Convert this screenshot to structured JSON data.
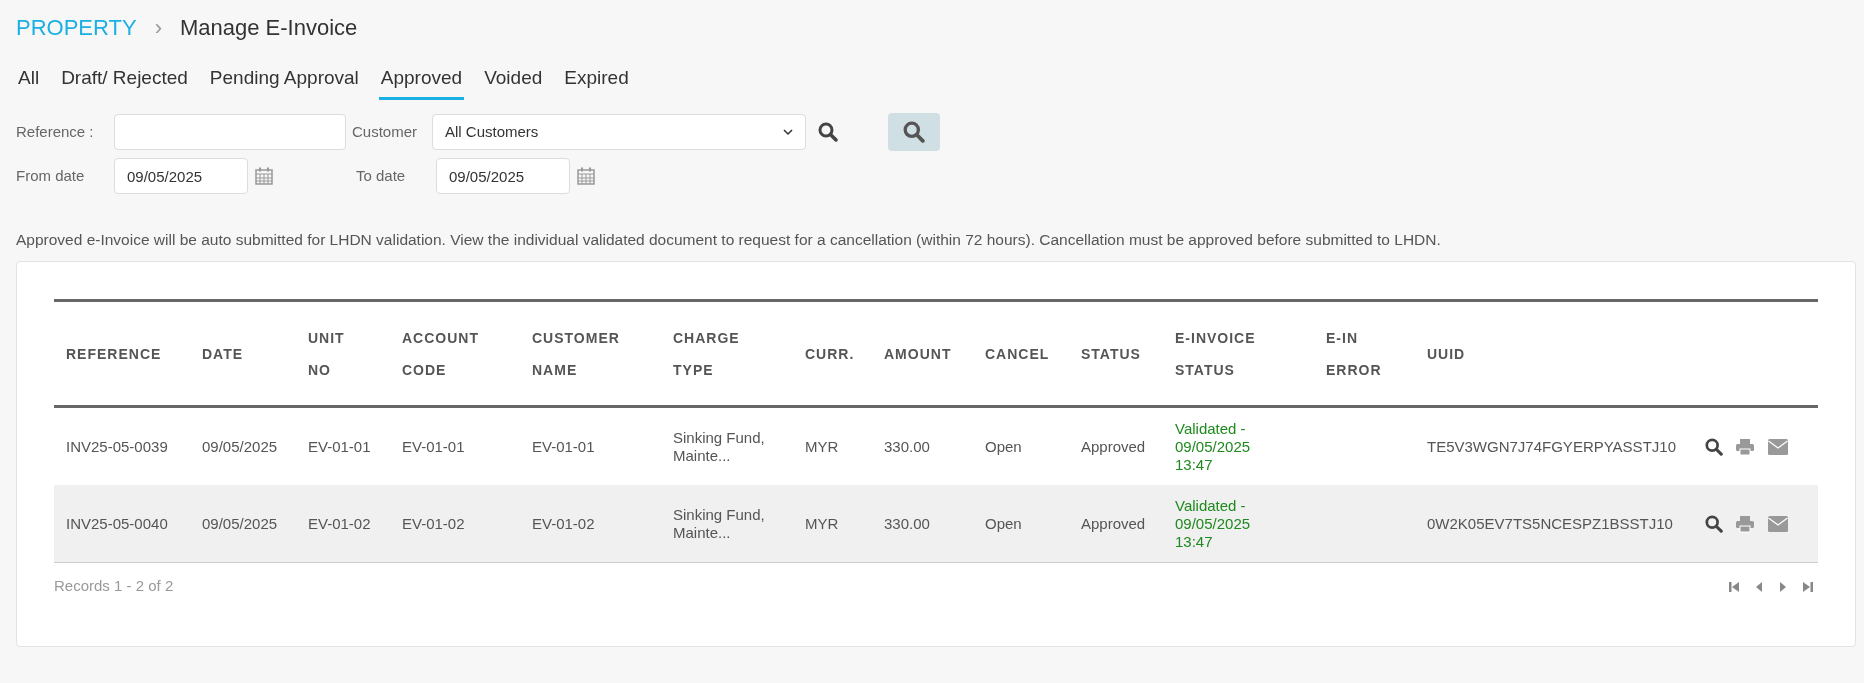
{
  "breadcrumb": {
    "root": "PROPERTY",
    "separator": "›",
    "current": "Manage E-Invoice"
  },
  "tabs": [
    {
      "label": "All",
      "selected": false
    },
    {
      "label": "Draft/ Rejected",
      "selected": false
    },
    {
      "label": "Pending Approval",
      "selected": false
    },
    {
      "label": "Approved",
      "selected": true
    },
    {
      "label": "Voided",
      "selected": false
    },
    {
      "label": "Expired",
      "selected": false
    }
  ],
  "filters": {
    "reference_label": "Reference :",
    "customer_label": "Customer",
    "customer_value": "All Customers",
    "from_label": "From date",
    "from_value": "09/05/2025",
    "to_label": "To date",
    "to_value": "09/05/2025"
  },
  "notice": "Approved e-Invoice will be auto submitted for LHDN validation. View the individual validated document to request for a cancellation (within 72 hours). Cancellation must be approved before submitted to LHDN.",
  "table": {
    "columns": [
      "REFERENCE",
      "DATE",
      "UNIT\nNO",
      "ACCOUNT\nCODE",
      "CUSTOMER\nNAME",
      "CHARGE\nTYPE",
      "CURR.",
      "AMOUNT",
      "CANCEL",
      "STATUS",
      "E-INVOICE\nSTATUS",
      "E-IN\nERROR",
      "UUID"
    ],
    "rows": [
      {
        "selected": false,
        "cells": [
          "INV25-05-0039",
          "09/05/2025",
          "EV-01-01",
          "EV-01-01",
          "EV-01-01",
          "Sinking Fund,\nMainte...",
          "MYR",
          "330.00",
          "Open",
          "Approved",
          "Validated -\n09/05/2025\n13:47",
          "",
          "TE5V3WGN7J74FGYERPYASSTJ10"
        ]
      },
      {
        "selected": true,
        "cells": [
          "INV25-05-0040",
          "09/05/2025",
          "EV-01-02",
          "EV-01-02",
          "EV-01-02",
          "Sinking Fund,\nMainte...",
          "MYR",
          "330.00",
          "Open",
          "Approved",
          "Validated -\n09/05/2025\n13:47",
          "",
          "0W2K05EV7TS5NCESPZ1BSSTJ10"
        ]
      }
    ]
  },
  "footer": {
    "records": "Records 1 - 2 of 2"
  }
}
